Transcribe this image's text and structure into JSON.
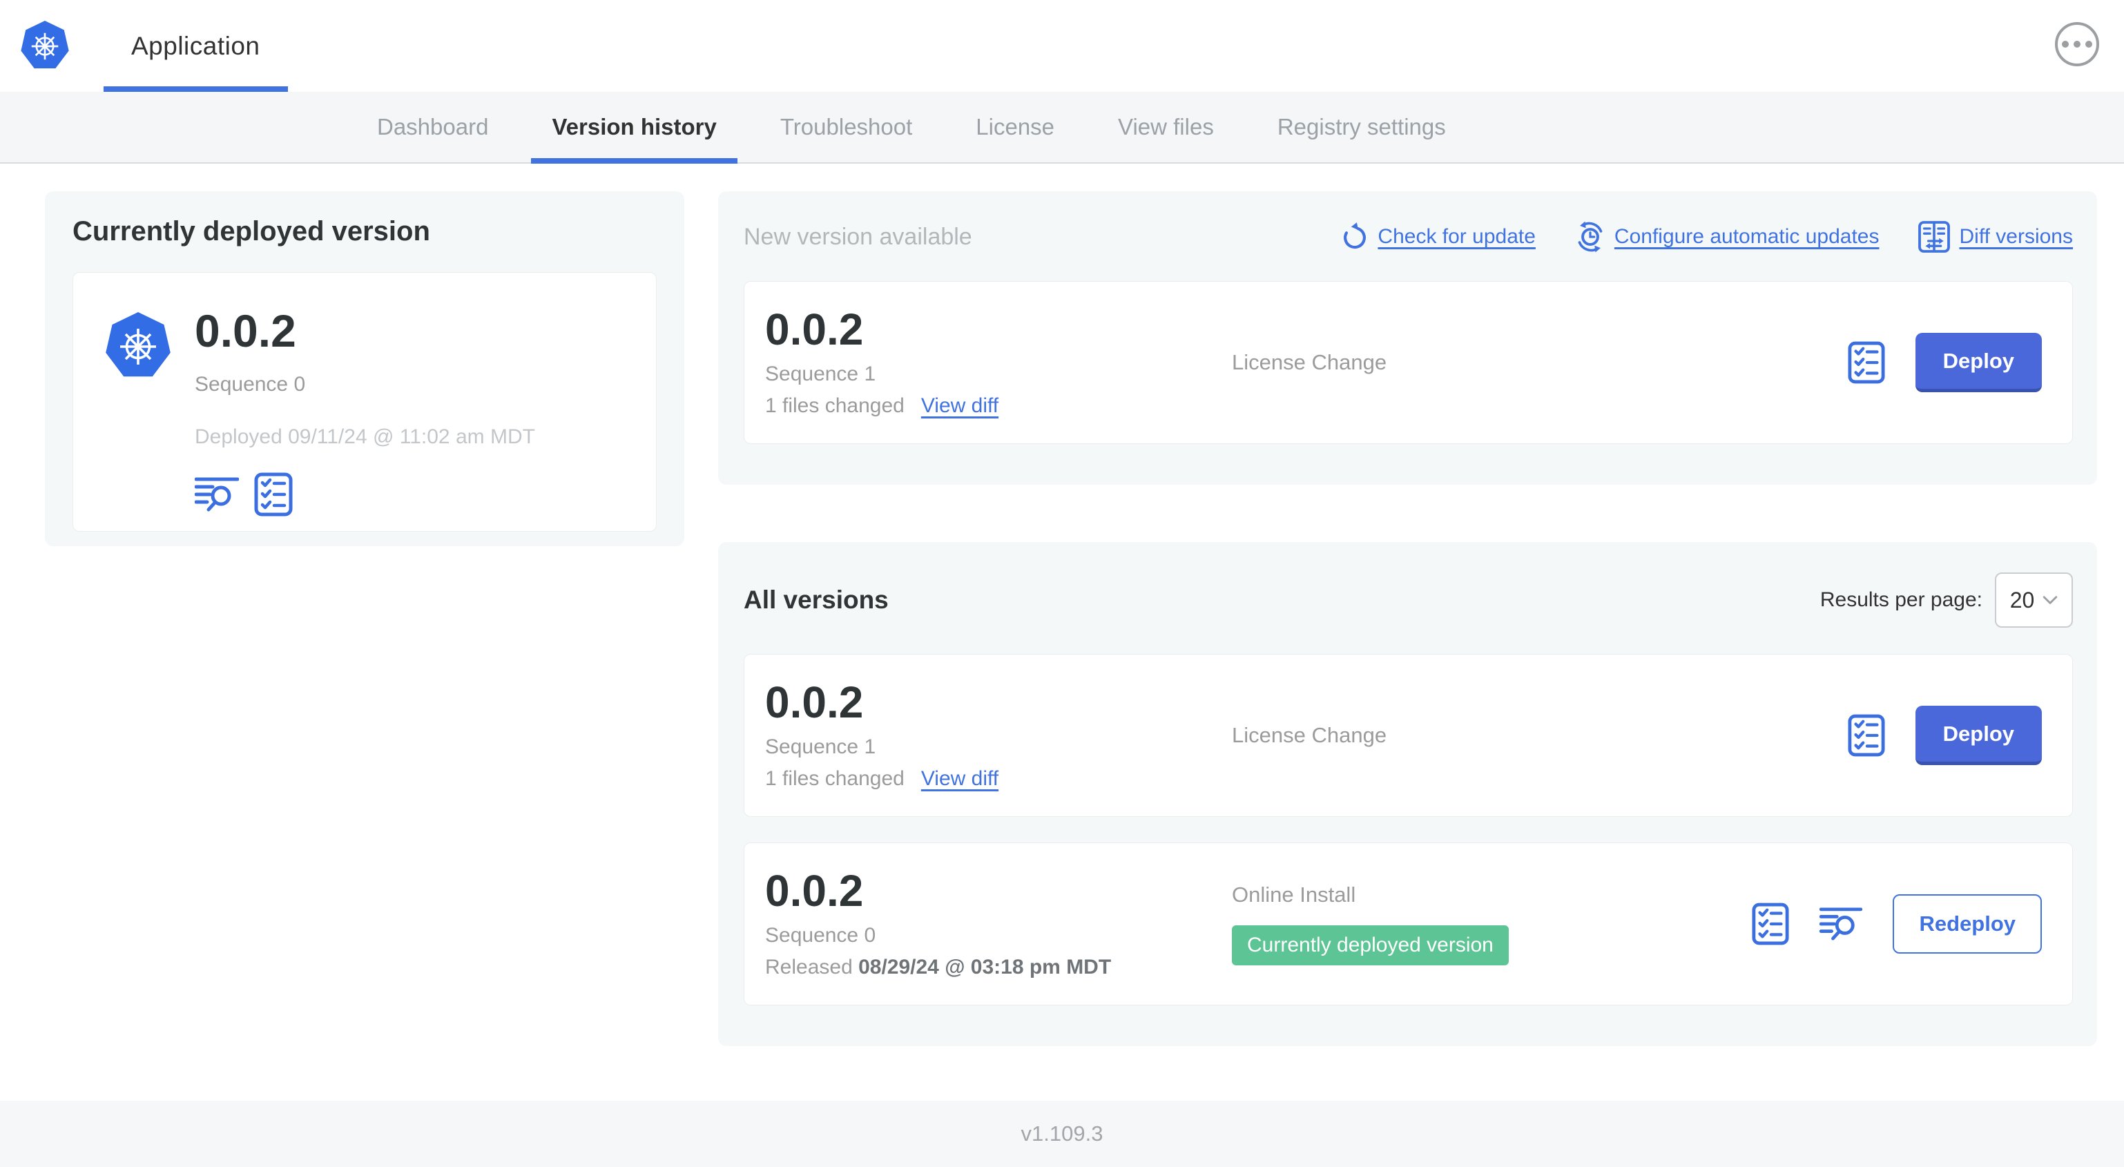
{
  "colors": {
    "accent_blue": "#4073e0",
    "button_blue": "#4a68d9",
    "k8s_blue": "#326de6",
    "badge_green": "#5dc595",
    "panel_gray": "#f5f8f9"
  },
  "header": {
    "app_label": "Application"
  },
  "nav": {
    "tabs": [
      {
        "label": "Dashboard",
        "active": false
      },
      {
        "label": "Version history",
        "active": true
      },
      {
        "label": "Troubleshoot",
        "active": false
      },
      {
        "label": "License",
        "active": false
      },
      {
        "label": "View files",
        "active": false
      },
      {
        "label": "Registry settings",
        "active": false
      }
    ]
  },
  "current": {
    "title": "Currently deployed version",
    "version": "0.0.2",
    "sequence": "Sequence 0",
    "deployed": "Deployed 09/11/24 @ 11:02 am MDT"
  },
  "new_version": {
    "heading": "New version available",
    "actions": [
      {
        "label": "Check for update",
        "icon": "refresh-icon"
      },
      {
        "label": "Configure automatic updates",
        "icon": "schedule-icon"
      },
      {
        "label": "Diff versions",
        "icon": "diff-icon"
      }
    ],
    "row": {
      "version": "0.0.2",
      "sequence": "Sequence 1",
      "files_changed": "1 files changed",
      "view_diff": "View diff",
      "source": "License Change",
      "action_label": "Deploy"
    }
  },
  "all_versions": {
    "title": "All versions",
    "per_page_label": "Results per page:",
    "per_page_value": "20",
    "rows": [
      {
        "version": "0.0.2",
        "sequence": "Sequence 1",
        "files_changed": "1 files changed",
        "view_diff": "View diff",
        "source": "License Change",
        "action_label": "Deploy"
      },
      {
        "version": "0.0.2",
        "sequence": "Sequence 0",
        "released_prefix": "Released ",
        "released_date": "08/29/24 @ 03:18 pm MDT",
        "source": "Online Install",
        "badge": "Currently deployed version",
        "action_label": "Redeploy"
      }
    ]
  },
  "footer": {
    "version": "v1.109.3"
  }
}
